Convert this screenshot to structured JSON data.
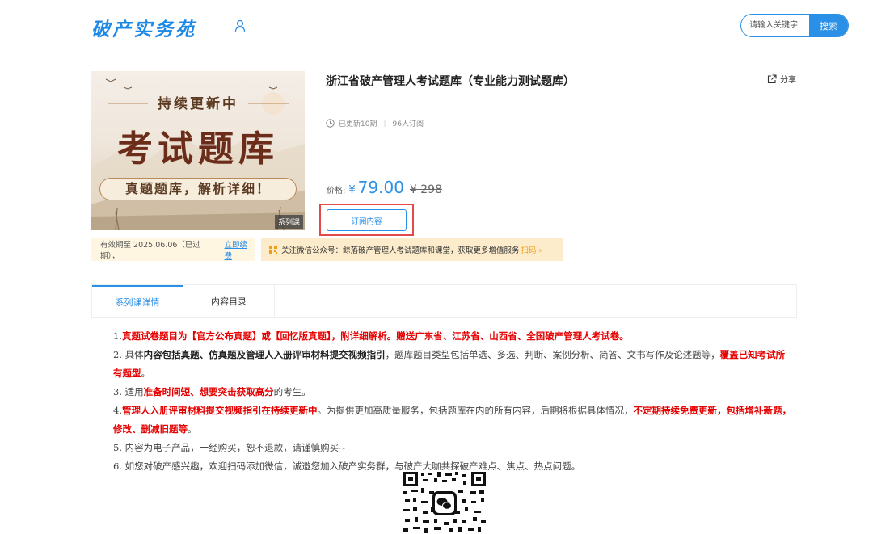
{
  "header": {
    "logo": "破产实务苑",
    "search_placeholder": "请输入关键字",
    "search_button": "搜索"
  },
  "cover": {
    "top_text": "持续更新中",
    "main_text": "考试题库",
    "ribbon_text": "真题题库，解析详细！",
    "tag": "系列课"
  },
  "product": {
    "title": "浙江省破产管理人考试题库（专业能力测试题库）",
    "share_label": "分享",
    "updated": "已更新10期",
    "subscribers": "96人订阅",
    "price_label": "价格:",
    "currency": "¥",
    "price": "79.00",
    "original_price": "¥ 298",
    "subscribe_button": "订阅内容"
  },
  "validity": {
    "text": "有效期至 2025.06.06（已过期），",
    "renew_link": "立即续费"
  },
  "wechat_bar": {
    "text": "关注微信公众号：鲸落破产管理人考试题库和课堂，获取更多增值服务",
    "scan": "扫码 ›"
  },
  "tabs": [
    {
      "label": "系列课详情",
      "active": true
    },
    {
      "label": "内容目录",
      "active": false
    }
  ],
  "content": {
    "l1_num": "1.",
    "l1_red": "真题试卷题目为【官方公布真题】或【回忆版真题】，附详细解析。赠送广东省、江苏省、山西省、全国破产管理人考试卷。",
    "l2_num": "2. 具体",
    "l2_bold": "内容包括真题、仿真题及管理人入册评审材料提交视频指引",
    "l2_text": "，题库题目类型包括单选、多选、判断、案例分析、简答、文书写作及论述题等，",
    "l2_red": "覆盖已知考试所有题型",
    "l2_end": "。",
    "l3_num": "3. 适用",
    "l3_red": "准备时间短、想要突击获取高分",
    "l3_text": "的考生。",
    "l4_num": "4.",
    "l4_red": "管理人入册评审材料提交视频指引在持续更新中",
    "l4_text": "。为提供更加高质量服务，包括题库在内的所有内容，后期将根据具体情况，",
    "l4_red2": "不定期持续免费更新，包括增补新题，修改、删减旧题等",
    "l4_end": "。",
    "l5": "5. 内容为电子产品，一经购买，恕不退款，请谨慎购买~",
    "l6": "6. 如您对破产感兴趣，欢迎扫码添加微信，诚邀您加入破产实务群，与破产大咖共探破产难点、焦点、热点问题。"
  },
  "colors": {
    "accent": "#2a8fe6",
    "red": "#e60000",
    "orange_bar": "#fdeccb"
  }
}
